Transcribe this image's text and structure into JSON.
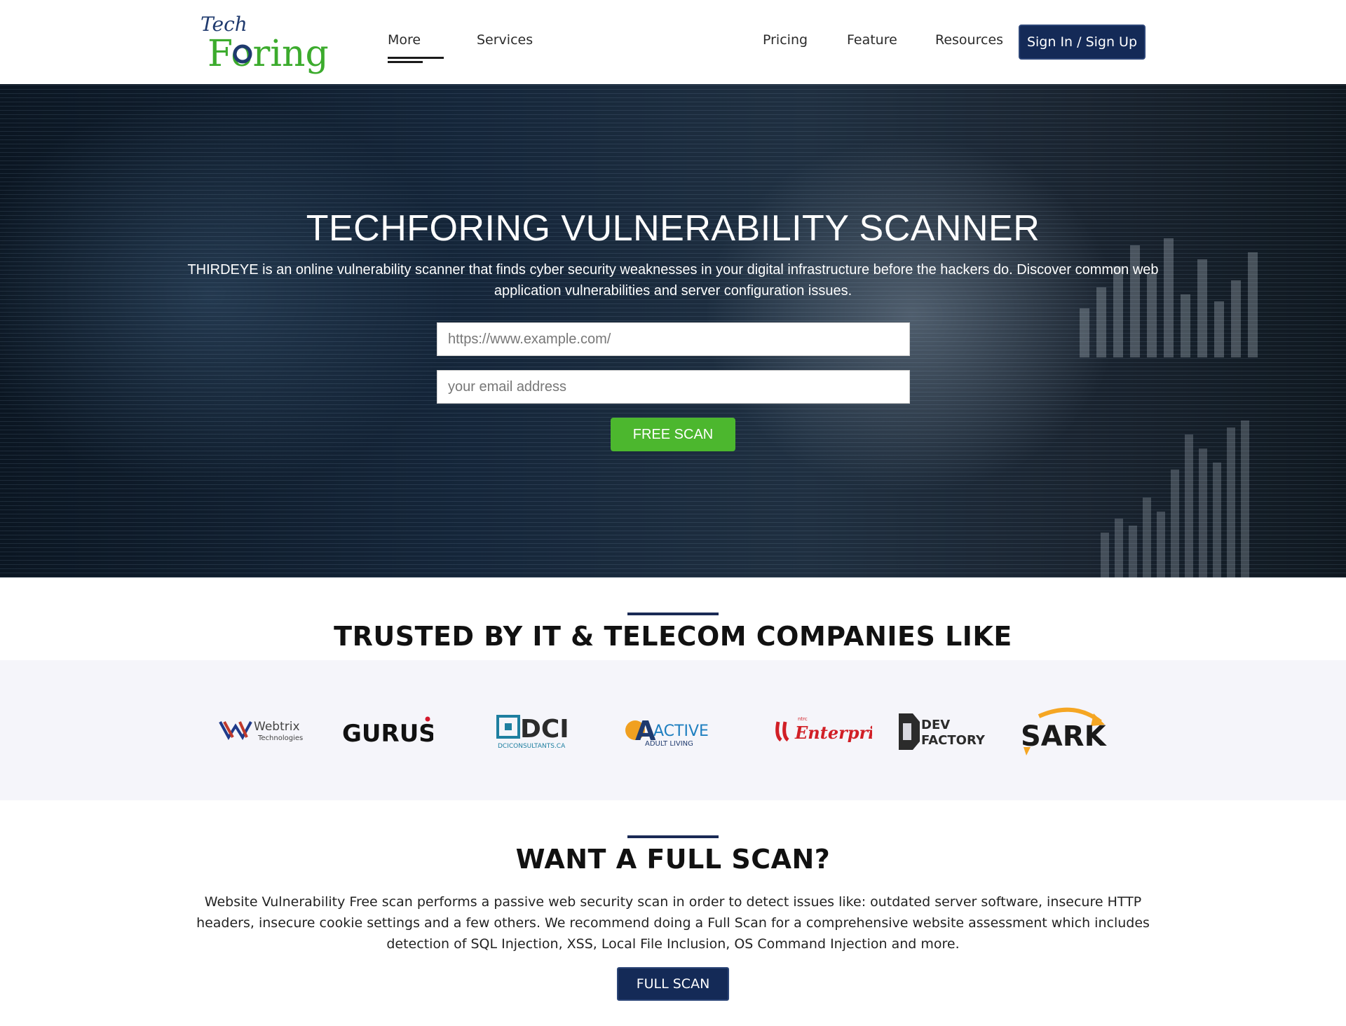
{
  "nav": {
    "logo_top": "Tech",
    "logo_bottom": "Foring",
    "more": "More",
    "services": "Services",
    "pricing": "Pricing",
    "feature": "Feature",
    "resources": "Resources",
    "signin": "Sign In / Sign Up"
  },
  "hero": {
    "title": "TECHFORING VULNERABILITY SCANNER",
    "description": "THIRDEYE is an online vulnerability scanner that finds cyber security weaknesses in your digital infrastructure before the hackers do. Discover common web application vulnerabilities and server configuration issues.",
    "url_placeholder": "https://www.example.com/",
    "email_placeholder": "your email address",
    "scan_button": "FREE SCAN"
  },
  "trusted": {
    "title": "TRUSTED BY IT & TELECOM COMPANIES LIKE",
    "logos": [
      {
        "name": "Webtrix",
        "sub": "Technologies"
      },
      {
        "name": "GURUS"
      },
      {
        "name": "DCI",
        "sub": "DCICONSULTANTS.CA"
      },
      {
        "name": "ACTIVE",
        "sub": "ADULT LIVING"
      },
      {
        "name": "Enterprise",
        "sub": "ntrc"
      },
      {
        "name": "DEV",
        "sub": "FACTORY"
      },
      {
        "name": "SARK"
      }
    ]
  },
  "full_scan": {
    "title": "WANT A FULL SCAN?",
    "description": "Website Vulnerability Free scan performs a passive web security scan in order to detect issues like: outdated server software, insecure HTTP headers, insecure cookie settings and a few others. We recommend doing a Full Scan for a comprehensive website assessment which includes detection of SQL Injection, XSS, Local File Inclusion, OS Command Injection and more.",
    "button": "FULL SCAN"
  },
  "colors": {
    "navy": "#142a57",
    "green": "#4cb72e",
    "logo_navy": "#1f3a6e",
    "logo_green": "#3cab2d"
  }
}
